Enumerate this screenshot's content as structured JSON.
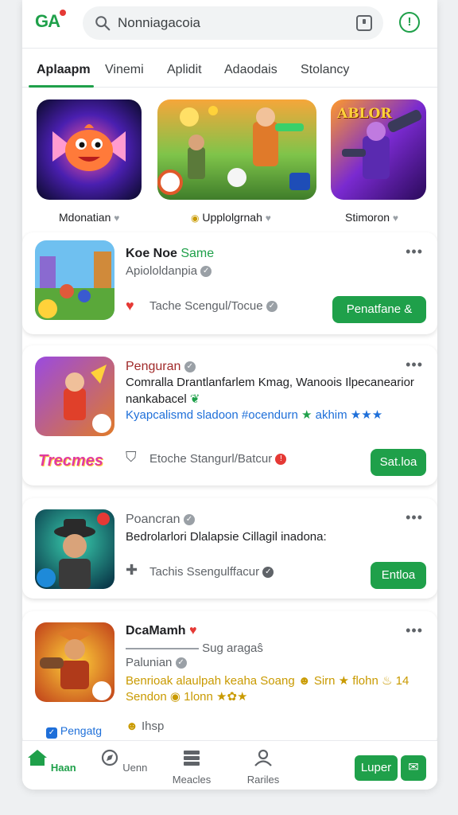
{
  "app": {
    "logo": "GA"
  },
  "search": {
    "value": "Nonniagacoia"
  },
  "tabs": [
    {
      "label": "Aplaapm"
    },
    {
      "label": "Vinemi"
    },
    {
      "label": "Aplidit"
    },
    {
      "label": "Adaodais"
    },
    {
      "label": "Stolancy"
    }
  ],
  "featured": [
    {
      "label": "Mdonatian"
    },
    {
      "label": "Upplolgrnah"
    },
    {
      "label": "Stimoron"
    }
  ],
  "featured_overlay": "ABLOR",
  "cards": [
    {
      "title_a": "Koe Noe",
      "title_b": "Same",
      "subtitle": "Apiololdanpia",
      "meta": "Tache Scengul/Tocue",
      "button": "Penatfane &"
    },
    {
      "title": "Penguran",
      "desc1": "Comralla Drantlanfarlem Kmag, Wanoois Ilpecanearior",
      "desc2": "nankabacel",
      "desc3": "Kyapcalismd sladoon #ocendurn",
      "desc3b": "akhim",
      "brand": "Trecmes",
      "meta": "Etoche Stangurl/Batcur",
      "button": "Sat.loa"
    },
    {
      "title": "Poancran",
      "desc1": "Bedrolarlori Dlalapsie Cillagil inadona:",
      "meta": "Tachis Ssengulffacur",
      "button": "Entloa"
    },
    {
      "title": "DcaMamh",
      "sub1": "Sug aragaŝ",
      "sub2": "Palunian",
      "desc1": "Benrioak alaulpah keaha Soang",
      "desc1b": "Sirn",
      "desc1c": "flohn",
      "desc1d": "14",
      "desc2": "Sendon",
      "desc2b": "1lonn",
      "link": "Pengatg",
      "meta": "Ihsp"
    }
  ],
  "bottom_nav": [
    {
      "label": "Haan"
    },
    {
      "label": "Uenn"
    },
    {
      "label": "Meacles"
    },
    {
      "label": "Rariles"
    }
  ],
  "user_button": "Luper",
  "colors": {
    "accent": "#1fa04a",
    "alert": "#e53935",
    "link": "#1e6fd9",
    "gold": "#c99a00"
  }
}
